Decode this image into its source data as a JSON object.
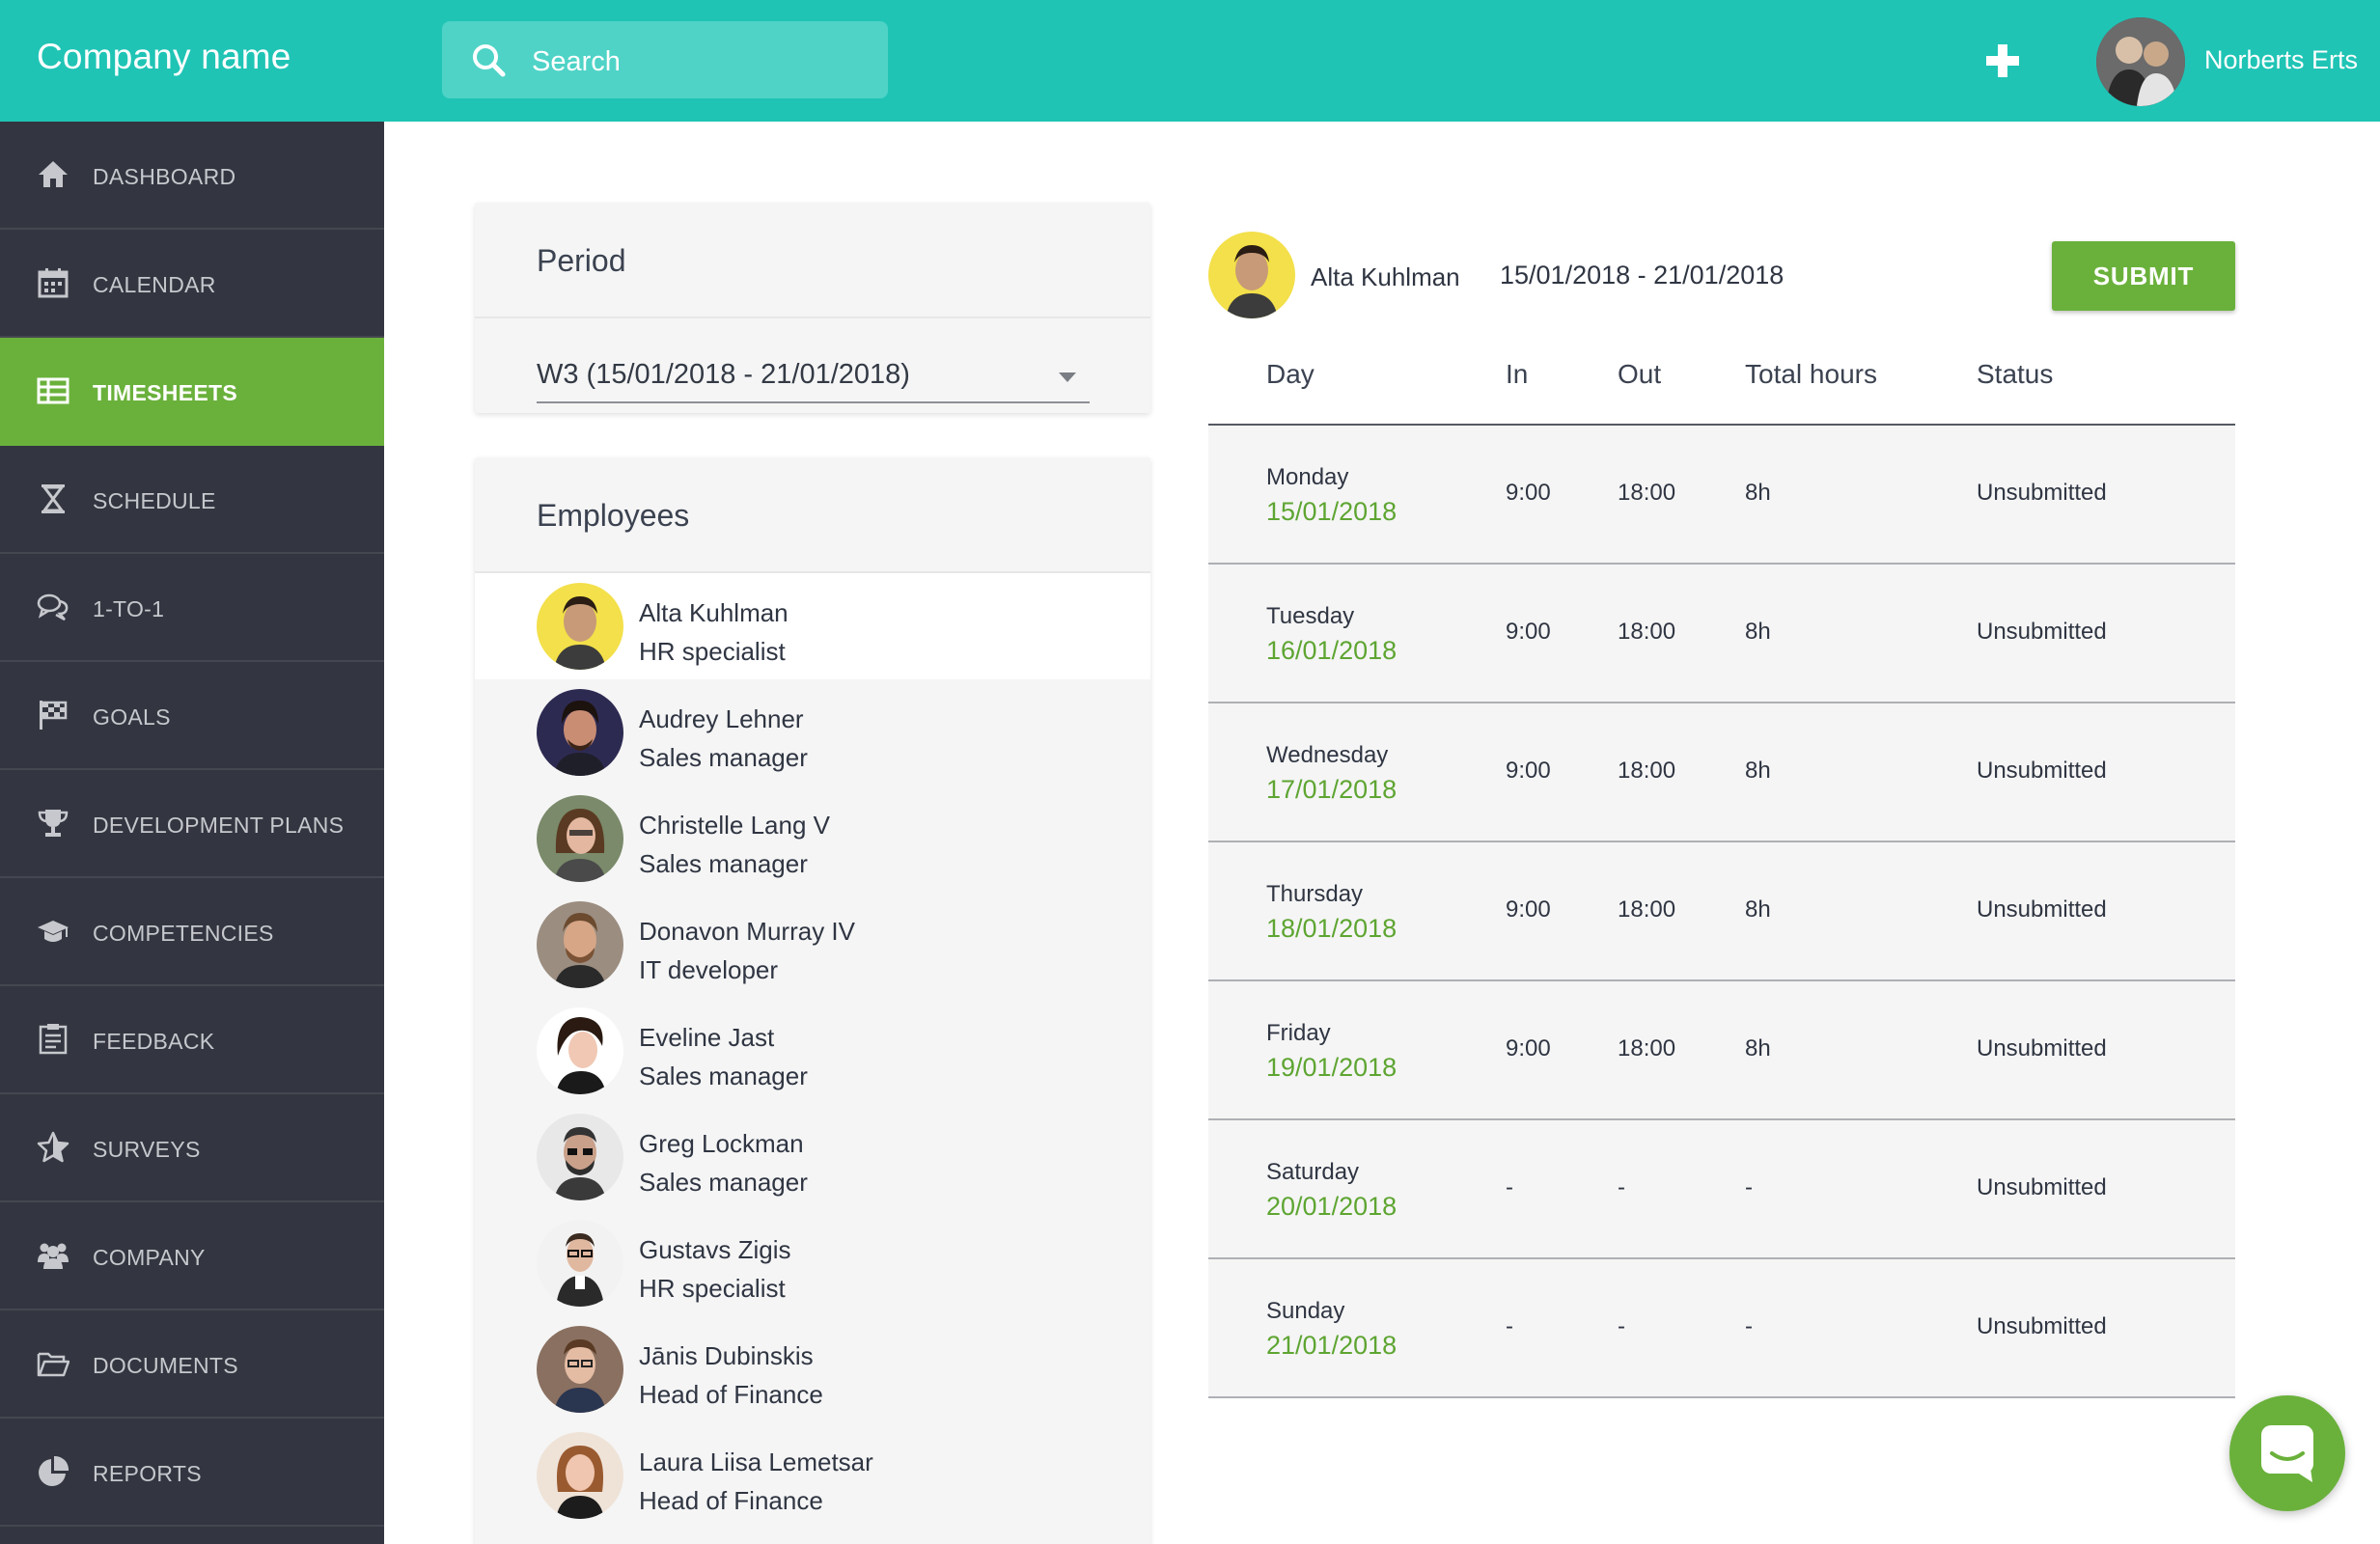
{
  "header": {
    "company_name": "Company name",
    "search_placeholder": "Search",
    "user_name": "Norberts Erts"
  },
  "sidebar": {
    "items": [
      {
        "label": "DASHBOARD",
        "icon": "home-icon"
      },
      {
        "label": "CALENDAR",
        "icon": "calendar-icon"
      },
      {
        "label": "TIMESHEETS",
        "icon": "table-icon",
        "active": true
      },
      {
        "label": "SCHEDULE",
        "icon": "hourglass-icon"
      },
      {
        "label": "1-TO-1",
        "icon": "chat-bubbles-icon"
      },
      {
        "label": "GOALS",
        "icon": "flag-icon"
      },
      {
        "label": "DEVELOPMENT PLANS",
        "icon": "trophy-icon"
      },
      {
        "label": "COMPETENCIES",
        "icon": "graduation-cap-icon"
      },
      {
        "label": "FEEDBACK",
        "icon": "clipboard-icon"
      },
      {
        "label": "SURVEYS",
        "icon": "star-icon"
      },
      {
        "label": "COMPANY",
        "icon": "users-icon"
      },
      {
        "label": "DOCUMENTS",
        "icon": "folder-icon"
      },
      {
        "label": "REPORTS",
        "icon": "pie-chart-icon"
      }
    ],
    "active_color": "#6ab13b"
  },
  "period": {
    "title": "Period",
    "selected": "W3 (15/01/2018 - 21/01/2018)"
  },
  "employees": {
    "title": "Employees",
    "list": [
      {
        "name": "Alta Kuhlman",
        "role": "HR specialist",
        "selected": true
      },
      {
        "name": "Audrey Lehner",
        "role": "Sales manager"
      },
      {
        "name": "Christelle Lang V",
        "role": "Sales manager"
      },
      {
        "name": "Donavon Murray IV",
        "role": "IT developer"
      },
      {
        "name": "Eveline Jast",
        "role": "Sales manager"
      },
      {
        "name": "Greg Lockman",
        "role": "Sales manager"
      },
      {
        "name": "Gustavs Zigis",
        "role": "HR specialist"
      },
      {
        "name": "Jānis Dubinskis",
        "role": "Head of Finance"
      },
      {
        "name": "Laura Liisa Lemetsar",
        "role": "Head of Finance"
      }
    ]
  },
  "timesheet": {
    "employee_name": "Alta Kuhlman",
    "range": "15/01/2018 - 21/01/2018",
    "submit_label": "SUBMIT",
    "columns": {
      "day": "Day",
      "in": "In",
      "out": "Out",
      "total": "Total hours",
      "status": "Status"
    },
    "rows": [
      {
        "day": "Monday",
        "date": "15/01/2018",
        "in": "9:00",
        "out": "18:00",
        "total": "8h",
        "status": "Unsubmitted"
      },
      {
        "day": "Tuesday",
        "date": "16/01/2018",
        "in": "9:00",
        "out": "18:00",
        "total": "8h",
        "status": "Unsubmitted"
      },
      {
        "day": "Wednesday",
        "date": "17/01/2018",
        "in": "9:00",
        "out": "18:00",
        "total": "8h",
        "status": "Unsubmitted"
      },
      {
        "day": "Thursday",
        "date": "18/01/2018",
        "in": "9:00",
        "out": "18:00",
        "total": "8h",
        "status": "Unsubmitted"
      },
      {
        "day": "Friday",
        "date": "19/01/2018",
        "in": "9:00",
        "out": "18:00",
        "total": "8h",
        "status": "Unsubmitted"
      },
      {
        "day": "Saturday",
        "date": "20/01/2018",
        "in": "-",
        "out": "-",
        "total": "-",
        "status": "Unsubmitted"
      },
      {
        "day": "Sunday",
        "date": "21/01/2018",
        "in": "-",
        "out": "-",
        "total": "-",
        "status": "Unsubmitted"
      }
    ]
  },
  "colors": {
    "header_bg": "#1fc4b5",
    "sidebar_bg": "#333640",
    "accent_green": "#6ab13b",
    "date_green": "#5ea532"
  }
}
